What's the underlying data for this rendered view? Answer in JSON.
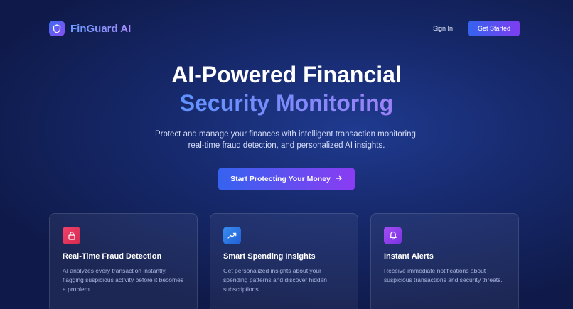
{
  "nav": {
    "brand": "FinGuard AI",
    "brand_icon": "shield-icon",
    "signin_label": "Sign In",
    "get_started_label": "Get Started"
  },
  "hero": {
    "title_line1": "AI-Powered Financial",
    "title_line2": "Security Monitoring",
    "subtitle_line1": "Protect and manage your finances with intelligent transaction monitoring,",
    "subtitle_line2": "real-time fraud detection, and personalized AI insights.",
    "cta_label": "Start Protecting Your Money",
    "cta_icon": "arrow-right-icon"
  },
  "features": [
    {
      "icon": "lock-icon",
      "color": "#e8345c",
      "title": "Real-Time Fraud Detection",
      "desc": "AI analyzes every transaction instantly, flagging suspicious activity before it becomes a problem."
    },
    {
      "icon": "trending-up-icon",
      "color": "#2f7be6",
      "title": "Smart Spending Insights",
      "desc": "Get personalized insights about your spending patterns and discover hidden subscriptions."
    },
    {
      "icon": "bell-icon",
      "color": "#9342ef",
      "title": "Instant Alerts",
      "desc": "Receive immediate notifications about suspicious transactions and security threats."
    }
  ],
  "colors": {
    "accent_start": "#3563ef",
    "accent_end": "#8b3cf2",
    "background": "#172a6e"
  }
}
